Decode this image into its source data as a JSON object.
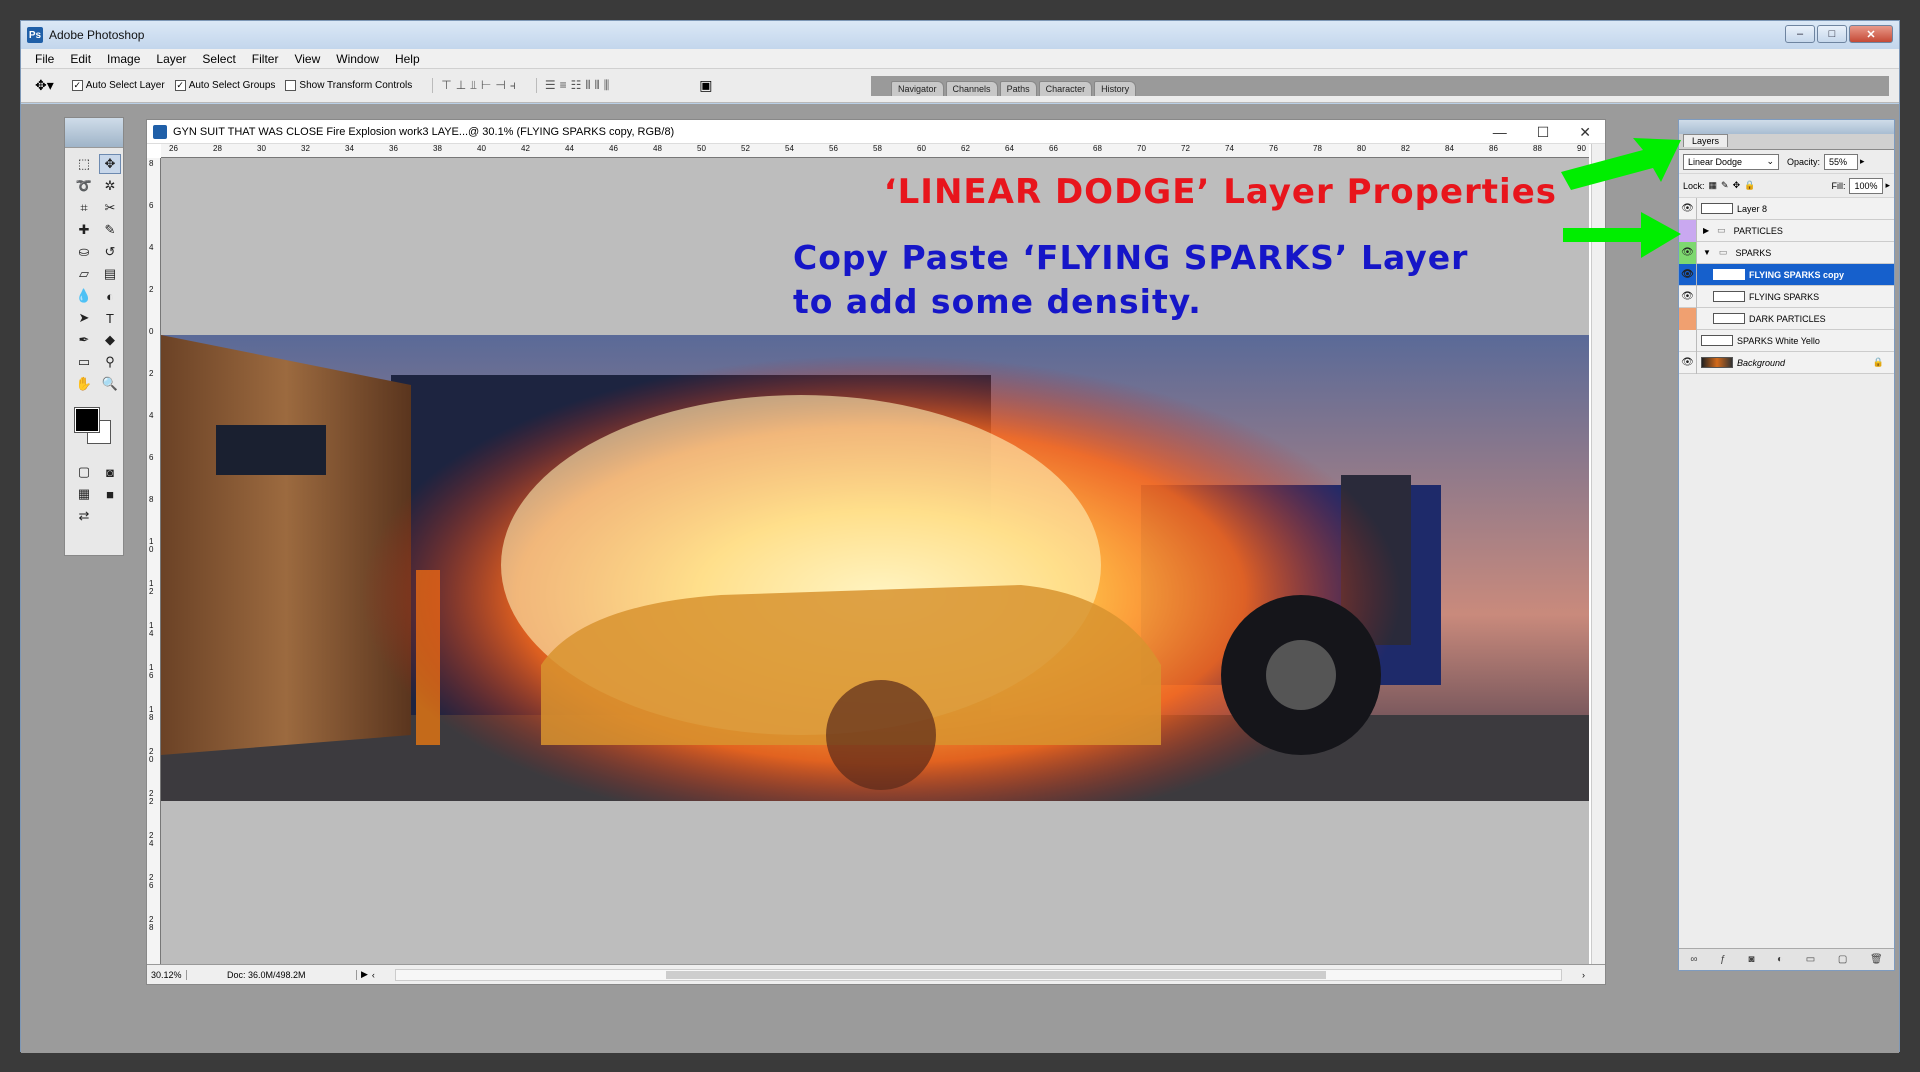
{
  "app": {
    "title": "Adobe Photoshop"
  },
  "menu": [
    "File",
    "Edit",
    "Image",
    "Layer",
    "Select",
    "Filter",
    "View",
    "Window",
    "Help"
  ],
  "options": {
    "auto_select_layer": "Auto Select Layer",
    "auto_select_groups": "Auto Select Groups",
    "show_transform": "Show Transform Controls"
  },
  "palette_well": [
    "Navigator",
    "Channels",
    "Paths",
    "Character",
    "History"
  ],
  "document": {
    "title": "GYN SUIT THAT WAS CLOSE Fire Explosion work3 LAYE...@ 30.1% (FLYING SPARKS copy, RGB/8)",
    "zoom": "30.12%",
    "doc_size": "Doc: 36.0M/498.2M",
    "h_ruler": [
      "26",
      "28",
      "30",
      "32",
      "34",
      "36",
      "38",
      "40",
      "42",
      "44",
      "46",
      "48",
      "50",
      "52",
      "54",
      "56",
      "58",
      "60",
      "62",
      "64",
      "66",
      "68",
      "70",
      "72",
      "74",
      "76",
      "78",
      "80",
      "82",
      "84",
      "86",
      "88",
      "90"
    ],
    "v_ruler": [
      "8",
      "6",
      "4",
      "2",
      "0",
      "2",
      "4",
      "6",
      "8",
      "1 0",
      "1 2",
      "1 4",
      "1 6",
      "1 8",
      "2 0",
      "2 2",
      "2 4",
      "2 6",
      "2 8"
    ]
  },
  "annotations": {
    "line1": "‘LINEAR DODGE’ Layer Properties",
    "line2a": "Copy Paste ‘FLYING SPARKS’ Layer",
    "line2b": "to add some density."
  },
  "colors": {
    "arrow": "#00ee00",
    "ann_red": "#e8151c",
    "ann_blue": "#1616c8",
    "selected": "#1660cc"
  },
  "layers_panel": {
    "tab": "Layers",
    "blend_mode": "Linear Dodge",
    "opacity_label": "Opacity:",
    "opacity": "55%",
    "lock_label": "Lock:",
    "fill_label": "Fill:",
    "fill": "100%",
    "layers": [
      {
        "name": "Layer 8",
        "visible": true,
        "color": "",
        "type": "layer"
      },
      {
        "name": "PARTICLES",
        "visible": false,
        "color": "#c9a8f0",
        "type": "group-collapsed"
      },
      {
        "name": "SPARKS",
        "visible": true,
        "color": "#7ed870",
        "type": "group-open"
      },
      {
        "name": "FLYING SPARKS copy",
        "visible": true,
        "color": "",
        "type": "layer",
        "selected": true
      },
      {
        "name": "FLYING SPARKS",
        "visible": true,
        "color": "",
        "type": "layer"
      },
      {
        "name": "DARK PARTICLES",
        "visible": false,
        "color": "#f0a070",
        "type": "layer"
      },
      {
        "name": "SPARKS White Yello",
        "visible": false,
        "color": "",
        "type": "layer"
      },
      {
        "name": "Background",
        "visible": true,
        "color": "",
        "type": "background"
      }
    ]
  }
}
